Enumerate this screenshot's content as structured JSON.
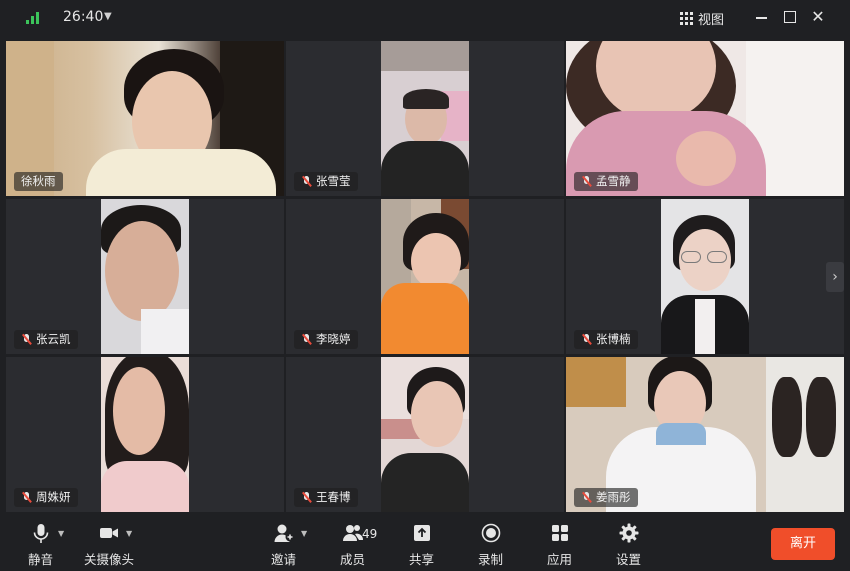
{
  "titlebar": {
    "timer": "26:40",
    "view_label": "视图"
  },
  "participants": [
    {
      "name": "徐秋雨"
    },
    {
      "name": "张雪莹"
    },
    {
      "name": "孟雪静"
    },
    {
      "name": "张云凯"
    },
    {
      "name": "李晓婷"
    },
    {
      "name": "张博楠"
    },
    {
      "name": "周姝妍"
    },
    {
      "name": "王春博"
    },
    {
      "name": "姜雨彤"
    }
  ],
  "toolbar": {
    "mute_label": "静音",
    "camera_label": "关摄像头",
    "invite_label": "邀请",
    "members_label": "成员",
    "members_count": "49",
    "share_label": "共享",
    "record_label": "录制",
    "apps_label": "应用",
    "settings_label": "设置",
    "leave_label": "离开"
  },
  "icons": {
    "signal": "signal-bars-icon",
    "view": "grid-view-icon",
    "mic": "microphone-icon",
    "camera": "video-camera-icon",
    "invite": "add-person-icon",
    "members": "people-icon",
    "share": "share-screen-icon",
    "record": "record-icon",
    "apps": "apps-icon",
    "settings": "gear-icon"
  },
  "colors": {
    "accent_green": "#1fa34a",
    "leave_red": "#f04e2a",
    "background": "#1f2023"
  }
}
